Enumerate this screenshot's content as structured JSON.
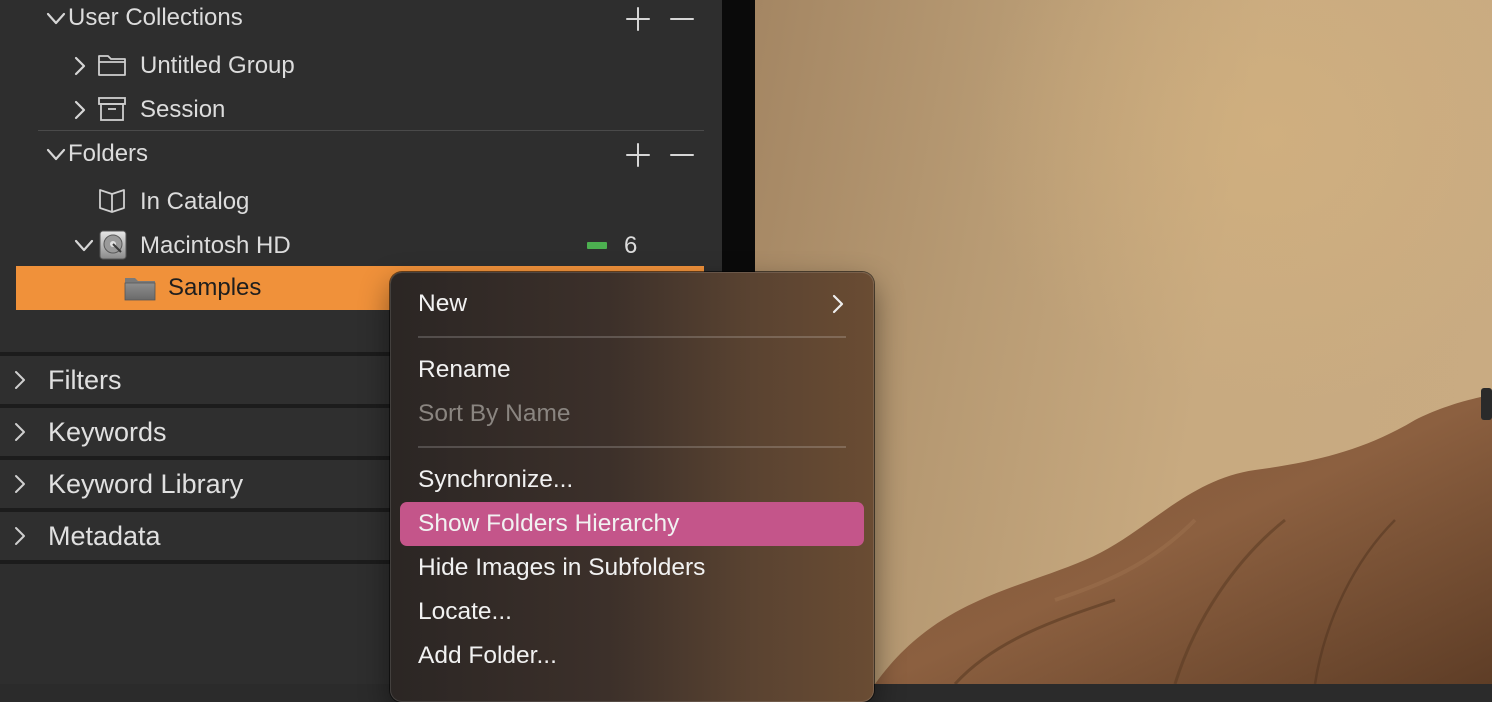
{
  "sidebar": {
    "user_collections": {
      "label": "User Collections",
      "items": [
        {
          "label": "Untitled Group",
          "icon": "folder-outline-icon"
        },
        {
          "label": "Session",
          "icon": "session-box-icon"
        }
      ]
    },
    "folders": {
      "label": "Folders",
      "items": [
        {
          "label": "In Catalog",
          "icon": "open-book-icon"
        },
        {
          "label": "Macintosh HD",
          "icon": "hard-drive-icon",
          "count": "6",
          "status_color": "#4caf50"
        }
      ],
      "selected": {
        "label": "Samples",
        "icon": "folder-filled-icon"
      }
    },
    "panels": [
      {
        "label": "Filters"
      },
      {
        "label": "Keywords"
      },
      {
        "label": "Keyword Library"
      },
      {
        "label": "Metadata"
      }
    ]
  },
  "context_menu": {
    "items": [
      {
        "label": "New",
        "submenu": true
      },
      {
        "label": "Rename"
      },
      {
        "label": "Sort By Name",
        "disabled": true
      },
      {
        "label": "Synchronize..."
      },
      {
        "label": "Show Folders Hierarchy",
        "highlighted": true
      },
      {
        "label": "Hide Images in Subfolders"
      },
      {
        "label": "Locate..."
      },
      {
        "label": "Add Folder..."
      }
    ]
  },
  "colors": {
    "selection": "#f0913a",
    "menu_highlight": "#c4558a"
  }
}
